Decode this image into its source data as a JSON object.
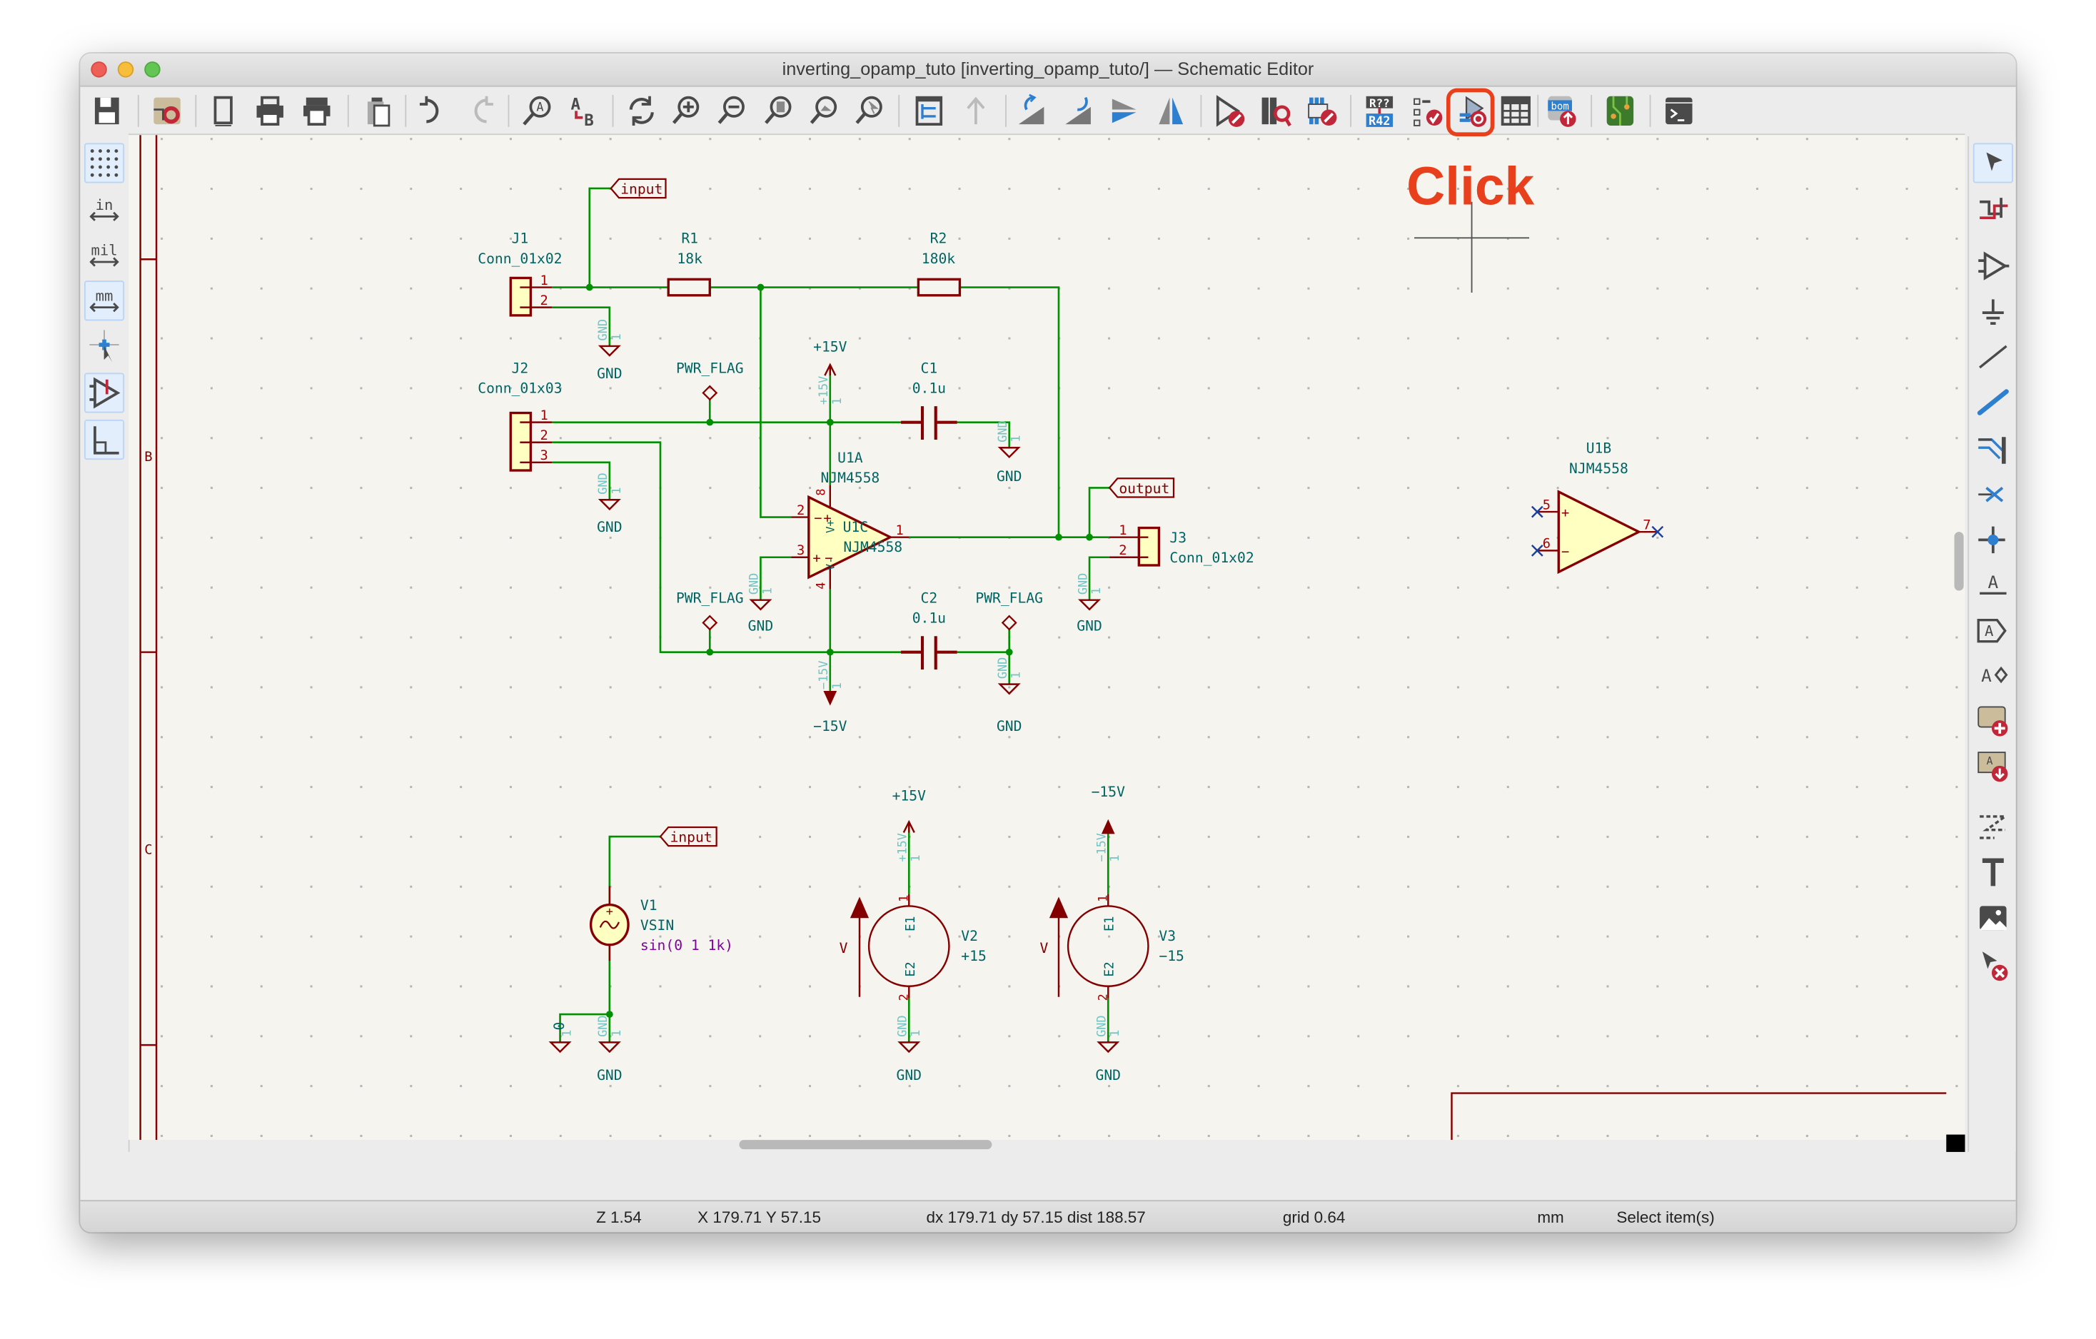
{
  "window": {
    "title": "inverting_opamp_tuto [inverting_opamp_tuto/] — Schematic Editor"
  },
  "toolbar": {
    "items": [
      {
        "name": "save-icon"
      },
      {
        "name": "schematic-setup-icon"
      },
      {
        "name": "page-settings-icon"
      },
      {
        "name": "print-icon"
      },
      {
        "name": "plot-icon"
      },
      {
        "name": "paste-icon"
      },
      {
        "name": "undo-icon"
      },
      {
        "name": "redo-icon"
      },
      {
        "name": "find-icon"
      },
      {
        "name": "find-replace-icon"
      },
      {
        "name": "refresh-icon"
      },
      {
        "name": "zoom-in-icon"
      },
      {
        "name": "zoom-out-icon"
      },
      {
        "name": "zoom-fit-icon"
      },
      {
        "name": "zoom-objects-icon"
      },
      {
        "name": "zoom-selection-icon"
      },
      {
        "name": "hierarchy-navigator-icon"
      },
      {
        "name": "leave-sheet-icon"
      },
      {
        "name": "rotate-ccw-icon"
      },
      {
        "name": "rotate-cw-icon"
      },
      {
        "name": "mirror-vertical-icon"
      },
      {
        "name": "mirror-horizontal-icon"
      },
      {
        "name": "symbol-editor-icon"
      },
      {
        "name": "symbol-library-browser-icon"
      },
      {
        "name": "footprint-assignment-icon"
      },
      {
        "name": "annotate-icon",
        "text_top": "R??",
        "text_bottom": "R42"
      },
      {
        "name": "erc-icon"
      },
      {
        "name": "simulator-icon",
        "highlighted": true
      },
      {
        "name": "symbol-fields-table-icon"
      },
      {
        "name": "bom-icon",
        "text": "bom"
      },
      {
        "name": "pcb-editor-icon"
      },
      {
        "name": "scripting-console-icon"
      }
    ]
  },
  "left_toolbar": {
    "items": [
      {
        "name": "grid-icon",
        "active": true
      },
      {
        "name": "units-inches-icon",
        "text": "in"
      },
      {
        "name": "units-mils-icon",
        "text": "mil"
      },
      {
        "name": "units-mm-icon",
        "text": "mm",
        "active": true
      },
      {
        "name": "cursor-crosshair-icon"
      },
      {
        "name": "hidden-pins-icon",
        "active": true
      },
      {
        "name": "line-mode-icon",
        "active": true
      }
    ]
  },
  "right_toolbar": {
    "items": [
      {
        "name": "select-icon",
        "active": true
      },
      {
        "name": "highlight-net-icon"
      },
      {
        "name": "add-symbol-icon"
      },
      {
        "name": "add-power-icon"
      },
      {
        "name": "add-wire-icon"
      },
      {
        "name": "add-bus-icon"
      },
      {
        "name": "add-bus-entry-icon"
      },
      {
        "name": "no-connect-icon"
      },
      {
        "name": "junction-icon"
      },
      {
        "name": "net-label-icon",
        "text": "A"
      },
      {
        "name": "global-label-icon",
        "text": "A"
      },
      {
        "name": "hierarchical-label-icon",
        "text": "A"
      },
      {
        "name": "add-sheet-icon"
      },
      {
        "name": "import-sheet-pin-icon"
      },
      {
        "name": "graphic-lines-icon"
      },
      {
        "name": "text-icon",
        "text": "T"
      },
      {
        "name": "image-icon"
      },
      {
        "name": "delete-icon"
      }
    ]
  },
  "annotation": {
    "text": "Click",
    "color": "#e8401c"
  },
  "sheet": {
    "row_letters": [
      "B",
      "C"
    ]
  },
  "schematic": {
    "J1": {
      "ref": "J1",
      "value": "Conn_01x02",
      "pins": [
        "1",
        "2"
      ]
    },
    "J2": {
      "ref": "J2",
      "value": "Conn_01x03",
      "pins": [
        "1",
        "2",
        "3"
      ]
    },
    "J3": {
      "ref": "J3",
      "value": "Conn_01x02",
      "pins": [
        "1",
        "2"
      ]
    },
    "R1": {
      "ref": "R1",
      "value": "18k"
    },
    "R2": {
      "ref": "R2",
      "value": "180k"
    },
    "C1": {
      "ref": "C1",
      "value": "0.1u"
    },
    "C2": {
      "ref": "C2",
      "value": "0.1u"
    },
    "U1A": {
      "ref": "U1A",
      "value": "NJM4558",
      "pins": [
        "2",
        "3",
        "1",
        "8",
        "4"
      ],
      "pin_names": [
        "V+",
        "V-"
      ]
    },
    "U1C": {
      "ref": "U1C",
      "value": "NJM4558"
    },
    "U1B": {
      "ref": "U1B",
      "value": "NJM4558",
      "pins": [
        "5",
        "6",
        "7"
      ]
    },
    "V1": {
      "ref": "V1",
      "value": "VSIN",
      "spice": "sin(0 1 1k)"
    },
    "V2": {
      "ref": "V2",
      "value": "+15",
      "pins": [
        "1",
        "2"
      ],
      "pin_names": [
        "E1",
        "E2"
      ],
      "arrow_label": "V"
    },
    "V3": {
      "ref": "V3",
      "value": "−15",
      "pins": [
        "1",
        "2"
      ],
      "pin_names": [
        "E1",
        "E2"
      ],
      "arrow_label": "V"
    },
    "labels": {
      "input": "input",
      "output": "output",
      "input2": "input"
    },
    "pwr_flags": [
      "PWR_FLAG",
      "PWR_FLAG",
      "PWR_FLAG"
    ],
    "power_symbols": [
      {
        "net": "GND",
        "pin": "1"
      },
      {
        "net": "GND",
        "pin": "1"
      },
      {
        "net": "GND",
        "pin": "1"
      },
      {
        "net": "GND",
        "pin": "1"
      },
      {
        "net": "GND",
        "pin": "1"
      },
      {
        "net": "GND",
        "pin": "1"
      },
      {
        "net": "GND",
        "pin": "1"
      },
      {
        "net": "GND",
        "pin": "1"
      },
      {
        "net": "GND",
        "pin": "1"
      },
      {
        "net": "+15V",
        "pin": "1"
      },
      {
        "net": "−15V",
        "pin": "1"
      },
      {
        "net": "+15V",
        "pin": "1"
      },
      {
        "net": "−15V",
        "pin": "1"
      },
      {
        "net": "0",
        "pin": "1"
      }
    ],
    "colors": {
      "wire": "#009000",
      "component": "#840000",
      "fill": "#ffffc2",
      "text": "#006464",
      "pin_number": "#a90000",
      "hidden": "#72c4c4",
      "spice": "#8000a0",
      "background": "#f5f4ef"
    }
  },
  "status": {
    "zoom": "Z 1.54",
    "coords": "X 179.71  Y 57.15",
    "delta": "dx 179.71  dy 57.15  dist 188.57",
    "grid": "grid 0.64",
    "units": "mm",
    "mode": "Select item(s)"
  }
}
